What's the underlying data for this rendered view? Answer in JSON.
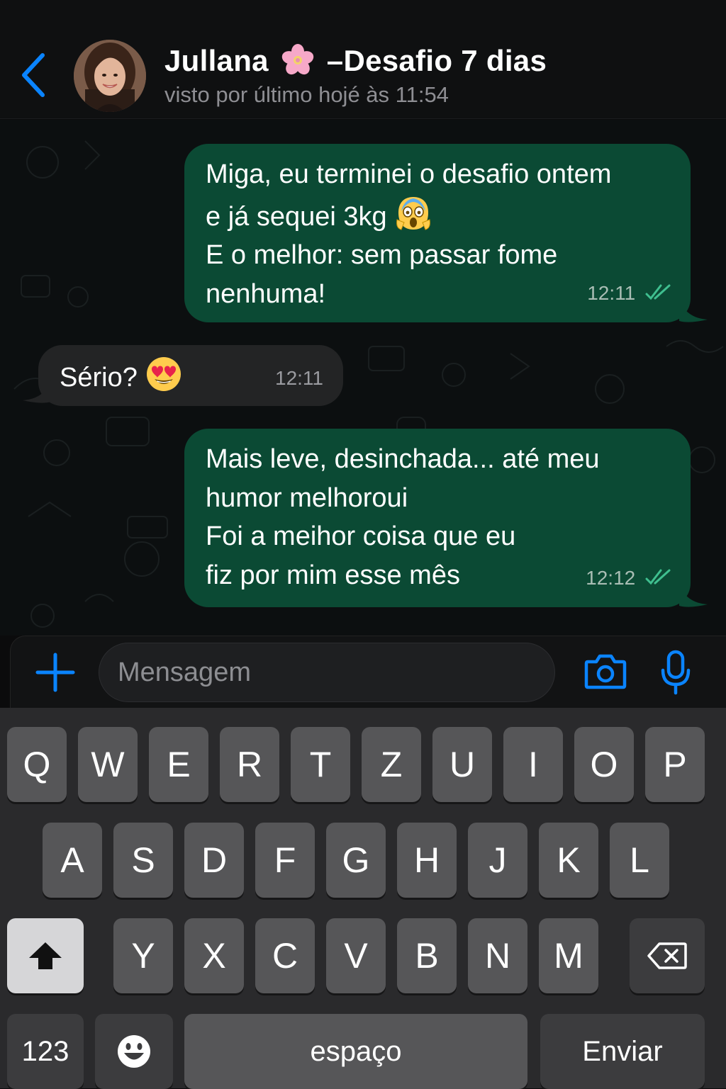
{
  "header": {
    "contact_name_part1": "Jullana",
    "contact_name_part2": "–Desafio 7 dias",
    "status": "visto por último hojé às 11:54"
  },
  "messages": [
    {
      "direction": "outgoing",
      "lines": [
        "Miga, eu terminei o desafio ontem",
        "e já sequei 3kg",
        "E o melhor: sem passar fome",
        "nenhuma!"
      ],
      "emoji": "screaming-face-emoji",
      "time": "12:11",
      "read": true
    },
    {
      "direction": "incoming",
      "lines": [
        "Sério?"
      ],
      "emoji": "heart-eyes-emoji",
      "time": "12:11"
    },
    {
      "direction": "outgoing",
      "lines": [
        "Mais leve, desinchada... até meu",
        "humor melhoroui",
        "Foi a meihor coisa que eu",
        "fiz por mim esse mês"
      ],
      "time": "12:12",
      "read": true
    }
  ],
  "composer": {
    "placeholder": "Mensagem"
  },
  "keyboard": {
    "row1": [
      "Q",
      "W",
      "E",
      "R",
      "T",
      "Z",
      "U",
      "I",
      "O",
      "P"
    ],
    "row2": [
      "A",
      "S",
      "D",
      "F",
      "G",
      "H",
      "J",
      "K",
      "L"
    ],
    "row3": [
      "Y",
      "X",
      "C",
      "V",
      "B",
      "N",
      "M"
    ],
    "numbers_label": "123",
    "space_label": "espaço",
    "send_label": "Enviar"
  },
  "colors": {
    "accent": "#0a84ff",
    "outgoing_bubble": "#0b4a34",
    "incoming_bubble": "#232425",
    "read_ticks": "#3fbf8f"
  }
}
